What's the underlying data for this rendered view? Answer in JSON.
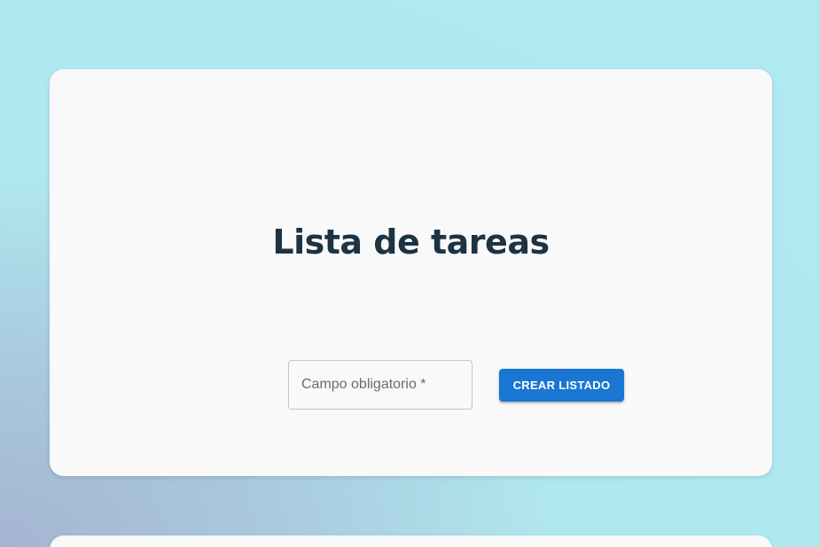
{
  "main_card": {
    "title": "Lista de tareas",
    "input": {
      "placeholder": "Campo obligatorio *",
      "value": ""
    },
    "create_button_label": "CREAR LISTADO"
  },
  "colors": {
    "background": "#b0eaf1",
    "card": "#f9f9f9",
    "title_text": "#1e3342",
    "button": "#1976d2",
    "button_text": "#ffffff"
  }
}
